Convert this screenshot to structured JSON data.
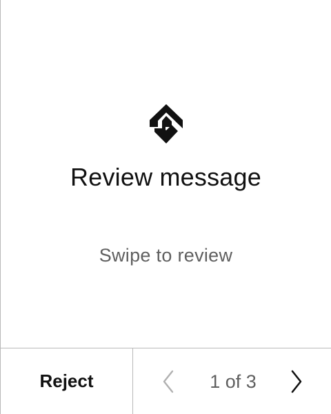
{
  "main": {
    "logo_icon": "conflux-logo-icon",
    "title": "Review message",
    "subtitle": "Swipe to review"
  },
  "footer": {
    "reject_label": "Reject",
    "pager": {
      "label": "1 of 3",
      "prev_icon": "chevron-left-icon",
      "next_icon": "chevron-right-icon",
      "prev_enabled": false,
      "next_enabled": true
    }
  },
  "colors": {
    "title": "#111111",
    "secondary_text": "#5f5f5f",
    "divider": "#b8b8b8",
    "disabled_icon": "#b0b0b0"
  }
}
